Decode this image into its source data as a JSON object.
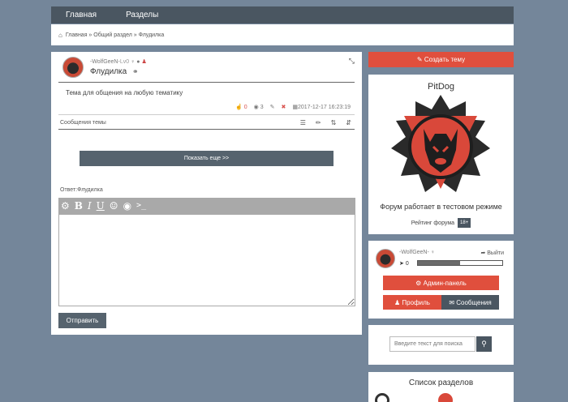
{
  "nav": {
    "home": "Главная",
    "sections": "Разделы"
  },
  "breadcrumb": "Главная » Общий раздел » Флудилка",
  "post": {
    "author": "-WolfGeeN-",
    "level": "Lv0",
    "title": "Флудилка",
    "description": "Тема для общения на любую тематику",
    "likes": "0",
    "views": "3",
    "date": "2017-12-17 16:23:19",
    "messages_label": "Сообщения темы"
  },
  "show_more": "Показать еще >>",
  "reply_label": "Ответ:Флудилка",
  "send_button": "Отправить",
  "sidebar": {
    "create_button": "Создать тему",
    "brand_name": "PitDog",
    "brand_desc": "Форум работает в тестовом режиме",
    "rating_label": "Рейтинг форума",
    "age_badge": "18+",
    "user": {
      "name": "-WolfGeeN-",
      "logout": "Выйти",
      "stat": "0",
      "progress": 0.5
    },
    "admin_button": "Админ-панель",
    "profile_button": "Профиль",
    "messages_button": "Сообщения",
    "search_placeholder": "Введите текст для поиска",
    "sections_title": "Список разделов"
  },
  "colors": {
    "accent": "#e04f3d",
    "dark": "#4a5661",
    "background": "#74869a"
  }
}
